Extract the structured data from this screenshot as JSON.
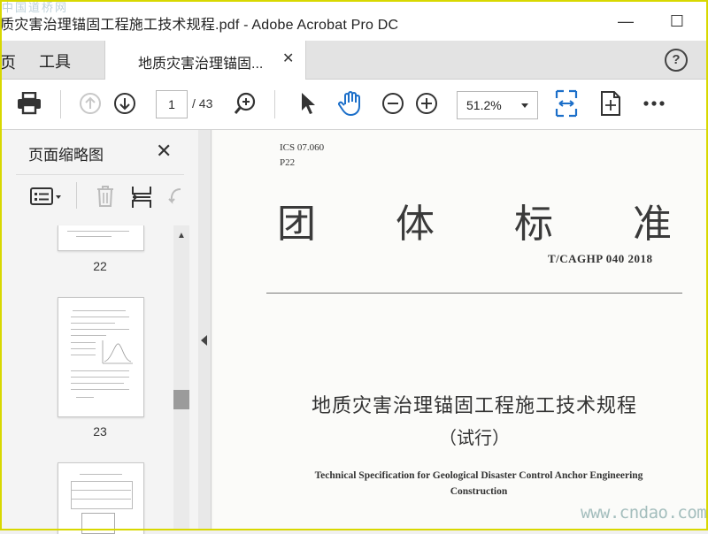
{
  "window": {
    "title": "质灾害治理锚固工程施工技术规程.pdf - Adobe Acrobat Pro DC",
    "watermark_text": "中国道桥网",
    "minimize_symbol": "—",
    "maximize_symbol": "☐"
  },
  "tabs": {
    "home_label": "页",
    "tools_label": "工具",
    "document_tab_label": "地质灾害治理锚固...",
    "close_symbol": "✕",
    "help_symbol": "?"
  },
  "toolbar": {
    "current_page": "1",
    "page_total": "/ 43",
    "zoom_value": "51.2%",
    "icons": [
      "print-icon",
      "prev-page-icon",
      "next-page-icon",
      "find-zoom-icon",
      "select-arrow-icon",
      "hand-tool-icon",
      "zoom-out-icon",
      "zoom-in-icon",
      "fit-width-icon",
      "rotate-fit-icon",
      "more-icon"
    ],
    "accent_color": "#1c6fc9"
  },
  "sidebar": {
    "title": "页面缩略图",
    "close_symbol": "✕",
    "thumbnails": [
      {
        "page_label": "22"
      },
      {
        "page_label": "23"
      }
    ]
  },
  "document": {
    "ics": "ICS  07.060",
    "classification": "P22",
    "big_title_chars": [
      "团",
      "体",
      "标",
      "准"
    ],
    "standard_number": "T/CAGHP 040   2018",
    "chinese_title": "地质灾害治理锚固工程施工技术规程",
    "trial_note": "（试行）",
    "english_title_line1": "Technical Specification for Geological Disaster Control Anchor Engineering",
    "english_title_line2": "Construction",
    "watermark": "www.cndao.com"
  }
}
